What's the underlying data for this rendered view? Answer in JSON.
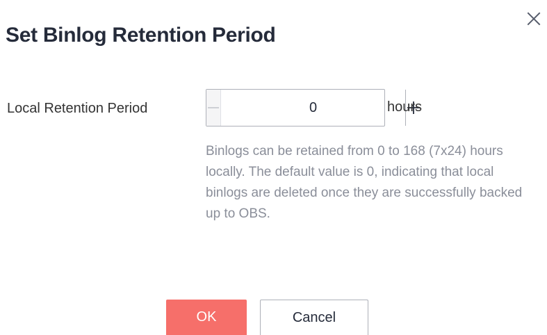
{
  "dialog": {
    "title": "Set Binlog Retention Period",
    "close_icon": "close-icon"
  },
  "form": {
    "field_label": "Local Retention Period",
    "stepper": {
      "value": "0",
      "minus_icon": "minus-icon",
      "plus_icon": "plus-icon",
      "minus_disabled": true
    },
    "unit": "hours",
    "hint": "Binlogs can be retained from 0 to 168 (7x24) hours locally. The default value is 0, indicating that local binlogs are deleted once they are successfully backed up to OBS."
  },
  "footer": {
    "ok_label": "OK",
    "cancel_label": "Cancel"
  },
  "colors": {
    "primary_button": "#f66f6a",
    "title_text": "#252b3a",
    "hint_text": "#8a8e99",
    "border": "#adb0b8"
  }
}
